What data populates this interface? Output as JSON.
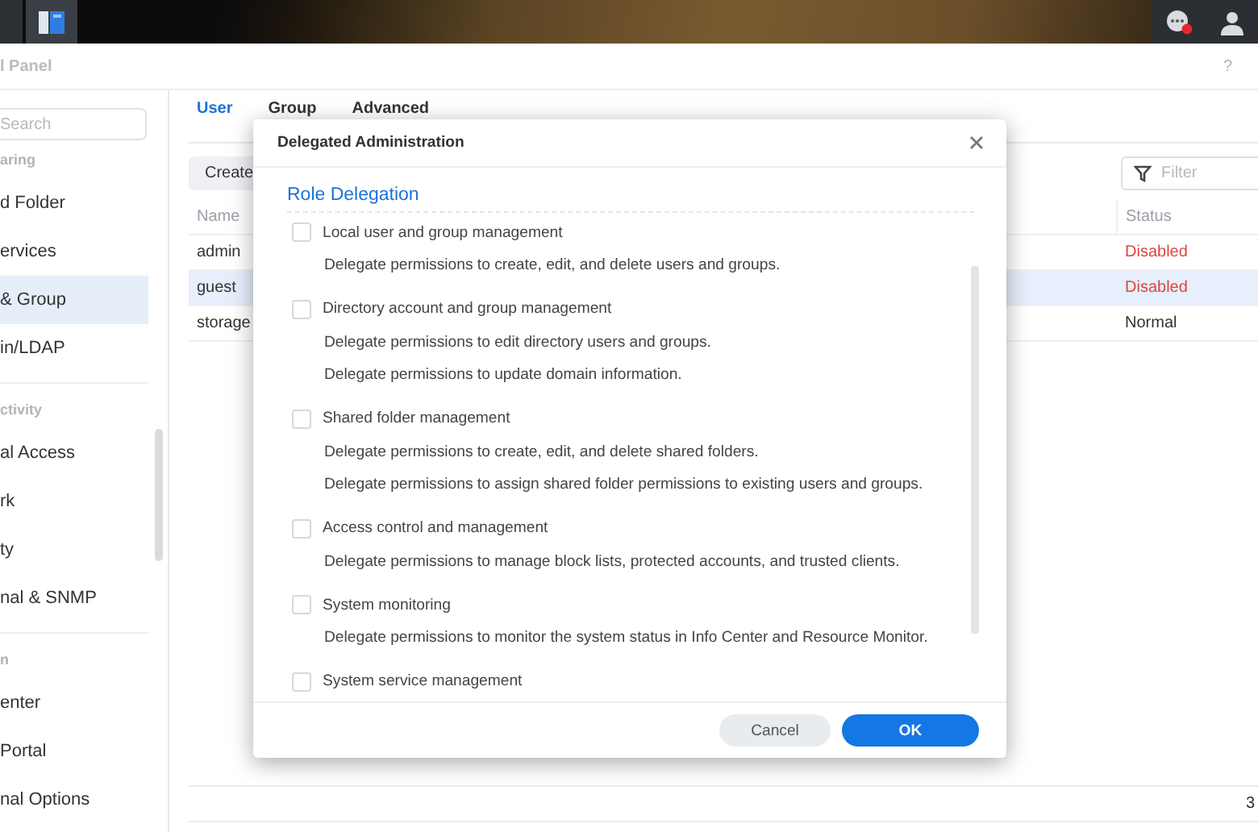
{
  "window": {
    "title": "l Panel",
    "help": "?"
  },
  "sidebar": {
    "search_placeholder": "Search",
    "sections": [
      {
        "title": "aring",
        "items": [
          {
            "label": "d Folder",
            "selected": false
          },
          {
            "label": "ervices",
            "selected": false
          },
          {
            "label": "& Group",
            "selected": true
          },
          {
            "label": "in/LDAP",
            "selected": false
          }
        ]
      },
      {
        "title": "ctivity",
        "items": [
          {
            "label": "al Access",
            "selected": false
          },
          {
            "label": "rk",
            "selected": false
          },
          {
            "label": "ty",
            "selected": false
          },
          {
            "label": "nal & SNMP",
            "selected": false
          }
        ]
      },
      {
        "title": "n",
        "items": [
          {
            "label": "enter",
            "selected": false
          },
          {
            "label": "Portal",
            "selected": false
          },
          {
            "label": "nal Options",
            "selected": false
          }
        ]
      }
    ]
  },
  "tabs": [
    {
      "label": "User",
      "selected": true
    },
    {
      "label": "Group",
      "selected": false
    },
    {
      "label": "Advanced",
      "selected": false
    }
  ],
  "toolbar": {
    "create_button": "Create",
    "filter_placeholder": "Filter"
  },
  "table": {
    "columns": [
      "Name",
      "Status"
    ],
    "rows": [
      {
        "name": "admin",
        "status": "Disabled",
        "kind": "alert",
        "selected": false
      },
      {
        "name": "guest",
        "status": "Disabled",
        "kind": "alert",
        "selected": true
      },
      {
        "name": "storage",
        "status": "Normal",
        "kind": "normal",
        "selected": false
      }
    ]
  },
  "footer": {
    "count": "3"
  },
  "dialog": {
    "title": "Delegated Administration",
    "heading": "Role Delegation",
    "options": [
      {
        "label": "Local user and group management",
        "checked": false,
        "descriptions": [
          "Delegate permissions to create, edit, and delete users and groups."
        ]
      },
      {
        "label": "Directory account and group management",
        "checked": false,
        "descriptions": [
          "Delegate permissions to edit directory users and groups.",
          "Delegate permissions to update domain information."
        ]
      },
      {
        "label": "Shared folder management",
        "checked": false,
        "descriptions": [
          "Delegate permissions to create, edit, and delete shared folders.",
          "Delegate permissions to assign shared folder permissions to existing users and groups."
        ]
      },
      {
        "label": "Access control and management",
        "checked": false,
        "descriptions": [
          "Delegate permissions to manage block lists, protected accounts, and trusted clients."
        ]
      },
      {
        "label": "System monitoring",
        "checked": false,
        "descriptions": [
          "Delegate permissions to monitor the system status in Info Center and Resource Monitor."
        ]
      },
      {
        "label": "System service management",
        "checked": false
      }
    ],
    "buttons": [
      {
        "label": "Cancel",
        "kind": "secondary"
      },
      {
        "label": "OK",
        "kind": "primary"
      }
    ]
  }
}
